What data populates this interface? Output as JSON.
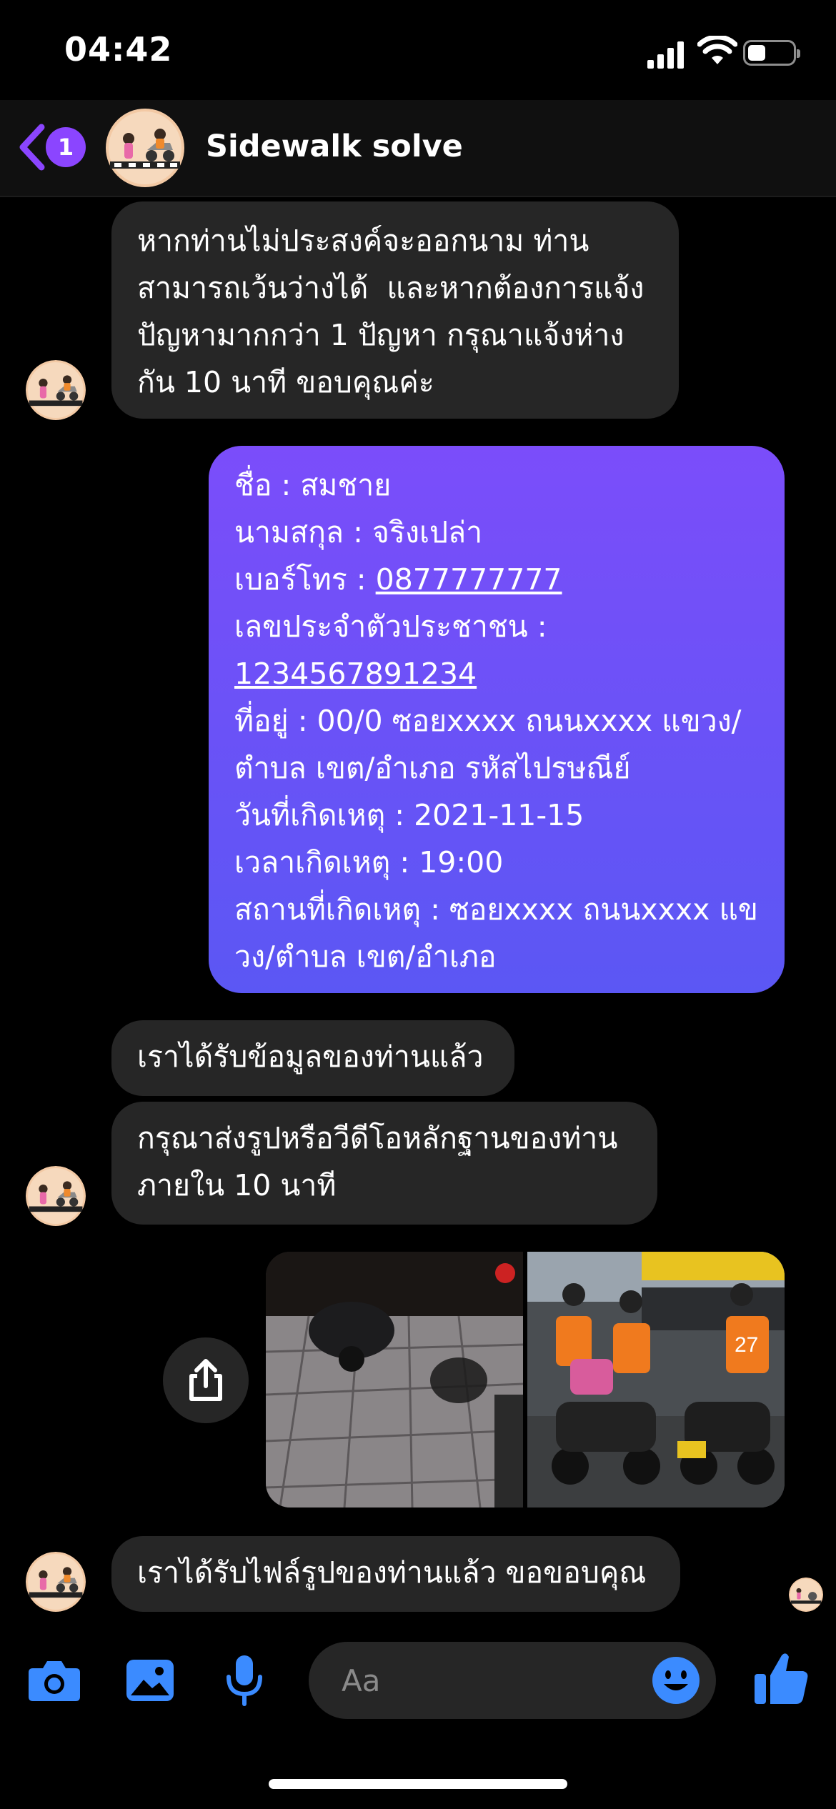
{
  "status_bar": {
    "time": "04:42"
  },
  "header": {
    "unread_count": "1",
    "contact_name": "Sidewalk solve"
  },
  "messages": {
    "m1": "หากท่านไม่ประสงค์จะออกนาม ท่าน\nสามารถเว้นว่างได้  และหากต้องการแจ้ง\nปัญหามากกว่า 1 ปัญหา กรุณาแจ้งห่าง\nกัน 10 นาที ขอบคุณค่ะ",
    "m2": {
      "name_line": "ชื่อ : สมชาย",
      "surname_line": "นามสกุล : จริงเปล่า",
      "phone_label": "เบอร์โทร  : ",
      "phone_value": "0877777777",
      "id_label": "เลขประจำตัวประชาชน  :",
      "id_value": "1234567891234",
      "address_line1": "ที่อยู่ : 00/0 ซอยxxxx ถนนxxxx แขวง/",
      "address_line2": "ตำบล เขต/อำเภอ รหัสไปรษณีย์",
      "date_line": "วันที่เกิดเหตุ : 2021-11-15",
      "time_line": "เวลาเกิดเหตุ : 19:00",
      "place_line1": "สถานที่เกิดเหตุ : ซอยxxxx ถนนxxxx แข",
      "place_line2": "วง/ตำบล เขต/อำเภอ"
    },
    "m3": "เราได้รับข้อมูลของท่านแล้ว",
    "m4": "กรุณาส่งรูปหรือวีดีโอหลักฐานของท่าน\nภายใน 10 นาที",
    "m5": "เราได้รับไฟล์รูปของท่านแล้ว ขอขอบคุณ"
  },
  "photos": {
    "photo2_badge": "27"
  },
  "composer": {
    "placeholder": "Aa"
  },
  "colors": {
    "accent": "#8b45ff",
    "icon_blue": "#3b8bff",
    "bubble_gray": "#262626",
    "bubble_purple_top": "#7b4dfa",
    "bubble_purple_bottom": "#5b57f4"
  }
}
